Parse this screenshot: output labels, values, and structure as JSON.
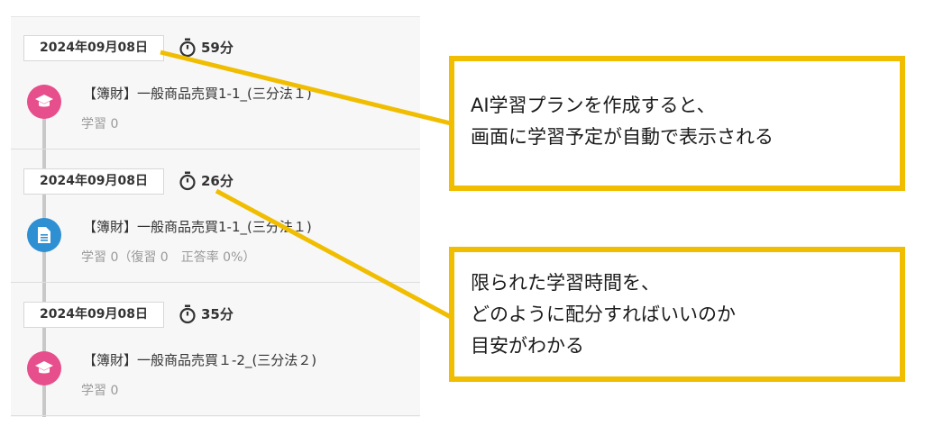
{
  "schedule": {
    "entries": [
      {
        "date": "2024年09月08日",
        "duration": "59分",
        "icon": "graduation-cap-icon",
        "title": "【簿財】一般商品売買1-1_(三分法１)",
        "meta": "学習 0"
      },
      {
        "date": "2024年09月08日",
        "duration": "26分",
        "icon": "document-icon",
        "title": "【簿財】一般商品売買1-1_(三分法１)",
        "meta": "学習 0（復習 0　正答率 0%）"
      },
      {
        "date": "2024年09月08日",
        "duration": "35分",
        "icon": "graduation-cap-icon",
        "title": "【簿財】一般商品売買１-2_(三分法２)",
        "meta": "学習 0"
      }
    ]
  },
  "callouts": {
    "first": {
      "line1": "AI学習プランを作成すると、",
      "line2": "画面に学習予定が自動で表示される"
    },
    "second": {
      "line1": "限られた学習時間を、",
      "line2": "どのように配分すればいいのか",
      "line3": "目安がわかる"
    }
  },
  "colors": {
    "callout_border": "#f0bd00",
    "lecture_icon": "#e64e8c",
    "exercise_icon": "#2e8fd3"
  }
}
